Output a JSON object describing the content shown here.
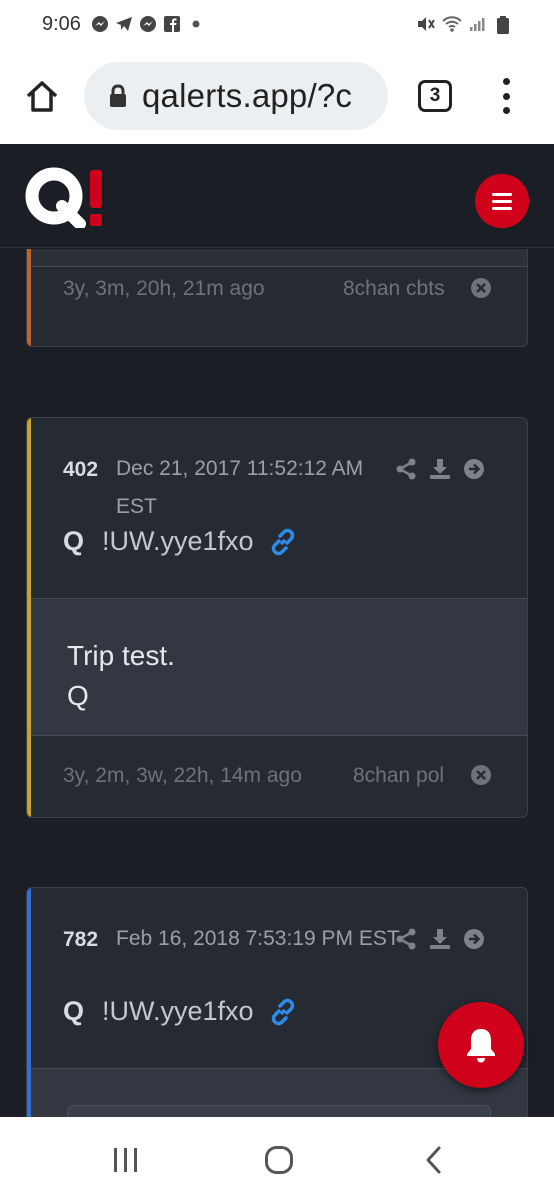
{
  "status_bar": {
    "time": "9:06",
    "notification_icons": [
      "messenger-icon",
      "telegram-icon",
      "messenger-icon",
      "facebook-icon",
      "dot-icon"
    ],
    "system_icons": [
      "mute-icon",
      "wifi-icon",
      "signal-icon",
      "battery-icon"
    ]
  },
  "browser": {
    "url": "qalerts.app/?c",
    "tab_count": "3"
  },
  "site": {
    "logo_letter": "Q",
    "logo_mark": "!",
    "accent_color": "#d0021b"
  },
  "posts": [
    {
      "ago": "3y, 3m, 20h, 21m ago",
      "source": "8chan cbts",
      "accent": "#c0642a"
    },
    {
      "number": "402",
      "date": "Dec 21, 2017 11:52:12 AM EST",
      "author": "Q",
      "trip": "!UW.yye1fxo",
      "body_lines": [
        "Trip test.",
        "Q"
      ],
      "ago": "3y, 2m, 3w, 22h, 14m ago",
      "source": "8chan pol",
      "accent": "#c9a227"
    },
    {
      "number": "782",
      "date": "Feb 16, 2018 7:53:19 PM EST",
      "author": "Q",
      "trip": "!UW.yye1fxo",
      "accent": "#2f6fd6"
    }
  ]
}
